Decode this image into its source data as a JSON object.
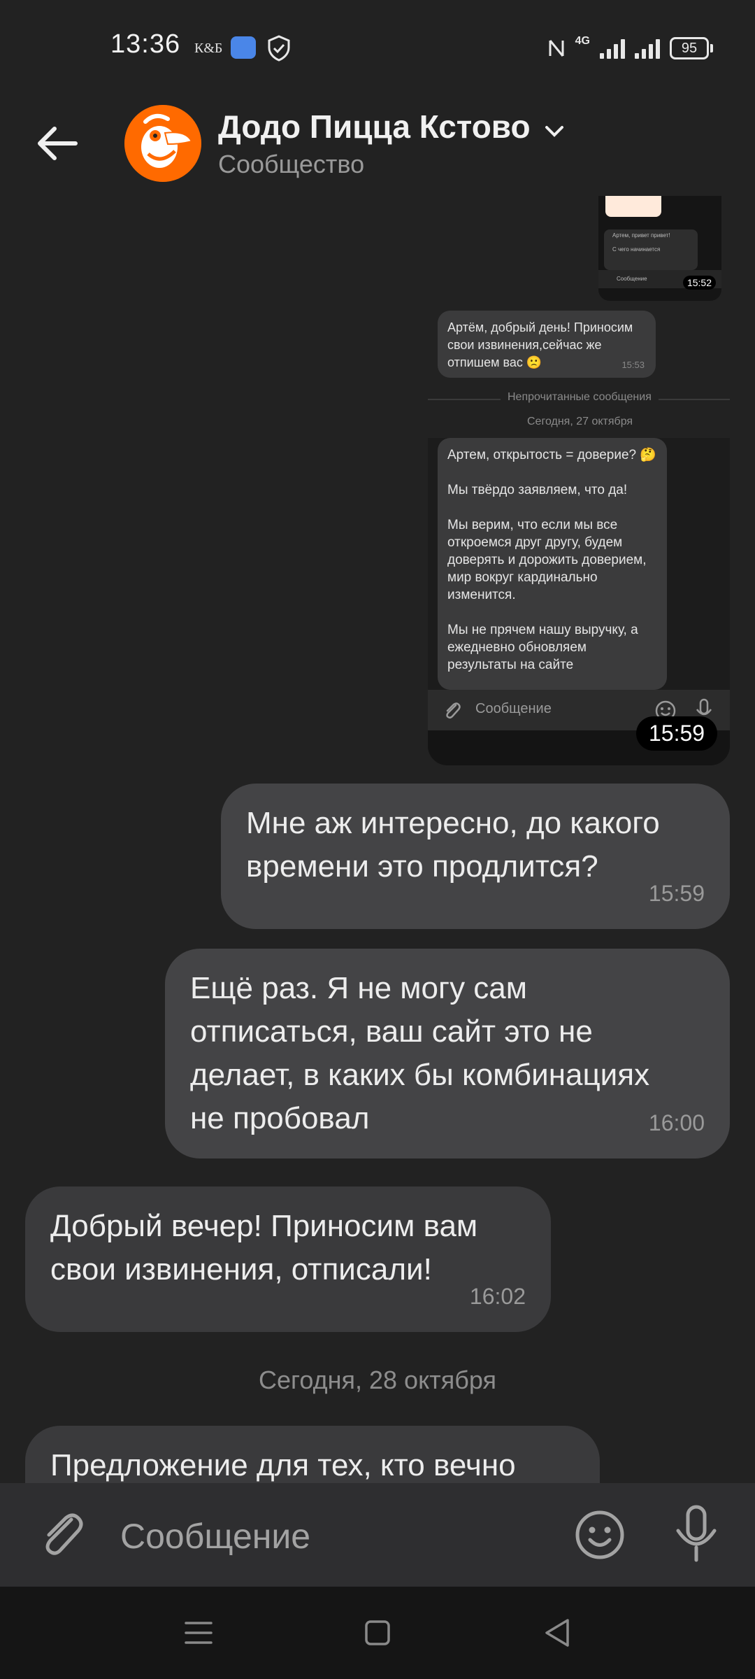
{
  "status_bar": {
    "time": "13:36",
    "carrier_badge": "К&Б",
    "network": "4G",
    "battery": "95"
  },
  "header": {
    "title": "Додо Пицца Кстово",
    "subtitle": "Сообщество"
  },
  "forwarded_screenshot": {
    "small": {
      "lines": [
        "Артем, привет привет!",
        "С чего начинается",
        "Сообщение"
      ],
      "time": "15:52"
    },
    "apology": {
      "text": "Артём, добрый день! Приносим свои извинения,сейчас же отпишем вас 🙁",
      "time": "15:53"
    },
    "unread_label": "Непрочитанные сообщения",
    "date_label": "Сегодня, 27 октября",
    "long_message": "Артем, открытость = доверие? 🤔\n\nМы твёрдо заявляем, что да!\n\nМы верим, что если мы все откроемся друг другу, будем доверять и дорожить доверием, мир вокруг кардинально изменится.\n\nМы не прячем нашу выручку, а ежедневно обновляем результаты на сайте",
    "input_placeholder": "Сообщение",
    "time": "15:59"
  },
  "messages": [
    {
      "direction": "out",
      "text": "Мне аж интересно, до какого\nвремени это продлится?",
      "time": "15:59"
    },
    {
      "direction": "out",
      "text": "Ещё раз. Я не могу сам\nотписаться, ваш сайт это не\nделает, в каких бы комбинациях\nне пробовал",
      "time": "16:00"
    },
    {
      "direction": "in",
      "text": "Добрый вечер! Приносим вам\nсвои извинения, отписали!",
      "time": "16:02"
    },
    {
      "direction": "in",
      "text": "Предложение для тех, кто вечно",
      "time": ""
    }
  ],
  "date_separator": "Сегодня, 28 октября",
  "composer": {
    "placeholder": "Сообщение"
  },
  "icons": {
    "back": "arrow-left-icon",
    "chevron": "chevron-down-icon",
    "attach": "paperclip-icon",
    "emoji": "smile-icon",
    "mic": "microphone-icon"
  },
  "colors": {
    "background": "#222222",
    "bubble_out": "#444446",
    "bubble_in": "#3a3a3c",
    "brand": "#ff6a00"
  }
}
